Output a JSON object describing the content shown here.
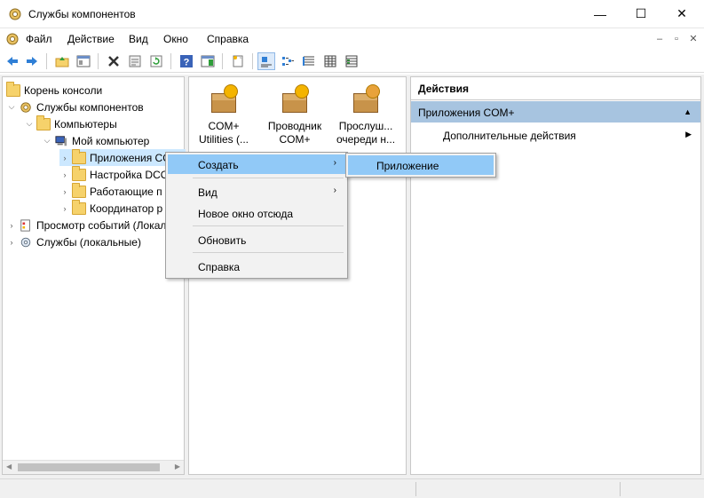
{
  "window": {
    "title": "Службы компонентов",
    "controls": {
      "minimize": "—",
      "maximize": "☐",
      "close": "✕"
    }
  },
  "menu": {
    "items": [
      "Файл",
      "Действие",
      "Вид",
      "Окно",
      "Справка"
    ],
    "mdi": {
      "minimize": "–",
      "restore": "▫",
      "close": "✕"
    }
  },
  "toolbar": {
    "buttons": [
      "back-icon",
      "forward-icon",
      "up-folder-icon",
      "show-tree-icon",
      "delete-icon",
      "properties-icon",
      "refresh-icon",
      "help-icon",
      "show-hide-icon",
      "export-icon",
      "large-icons-view-icon",
      "small-icons-view-icon",
      "list-view-icon",
      "details-view-icon",
      "status-view-icon"
    ]
  },
  "tree": {
    "items": [
      {
        "label": "Корень консоли",
        "level": 0
      },
      {
        "label": "Службы компонентов",
        "level": 1
      },
      {
        "label": "Компьютеры",
        "level": 2
      },
      {
        "label": "Мой компьютер",
        "level": 3
      },
      {
        "label": "Приложения CO",
        "level": 4
      },
      {
        "label": "Настройка DCO",
        "level": 4
      },
      {
        "label": "Работающие п",
        "level": 4
      },
      {
        "label": "Координатор р",
        "level": 4
      },
      {
        "label": "Просмотр событий (Локал",
        "level": 0
      },
      {
        "label": "Службы (локальные)",
        "level": 0
      }
    ]
  },
  "content": {
    "items": [
      {
        "line1": "COM+",
        "line2": "Utilities (..."
      },
      {
        "line1": "Проводник",
        "line2": "COM+"
      },
      {
        "line1": "Прослуш...",
        "line2": "очереди н..."
      }
    ]
  },
  "actions": {
    "header": "Действия",
    "group": "Приложения COM+",
    "item": "Дополнительные действия"
  },
  "context_menu": {
    "create": "Создать",
    "view": "Вид",
    "new_window": "Новое окно отсюда",
    "refresh": "Обновить",
    "help": "Справка",
    "submenu_item": "Приложение"
  },
  "colors": {
    "selection": "#cce8ff",
    "menu_highlight": "#91c9f7",
    "actions_group": "#a7c4e0"
  }
}
